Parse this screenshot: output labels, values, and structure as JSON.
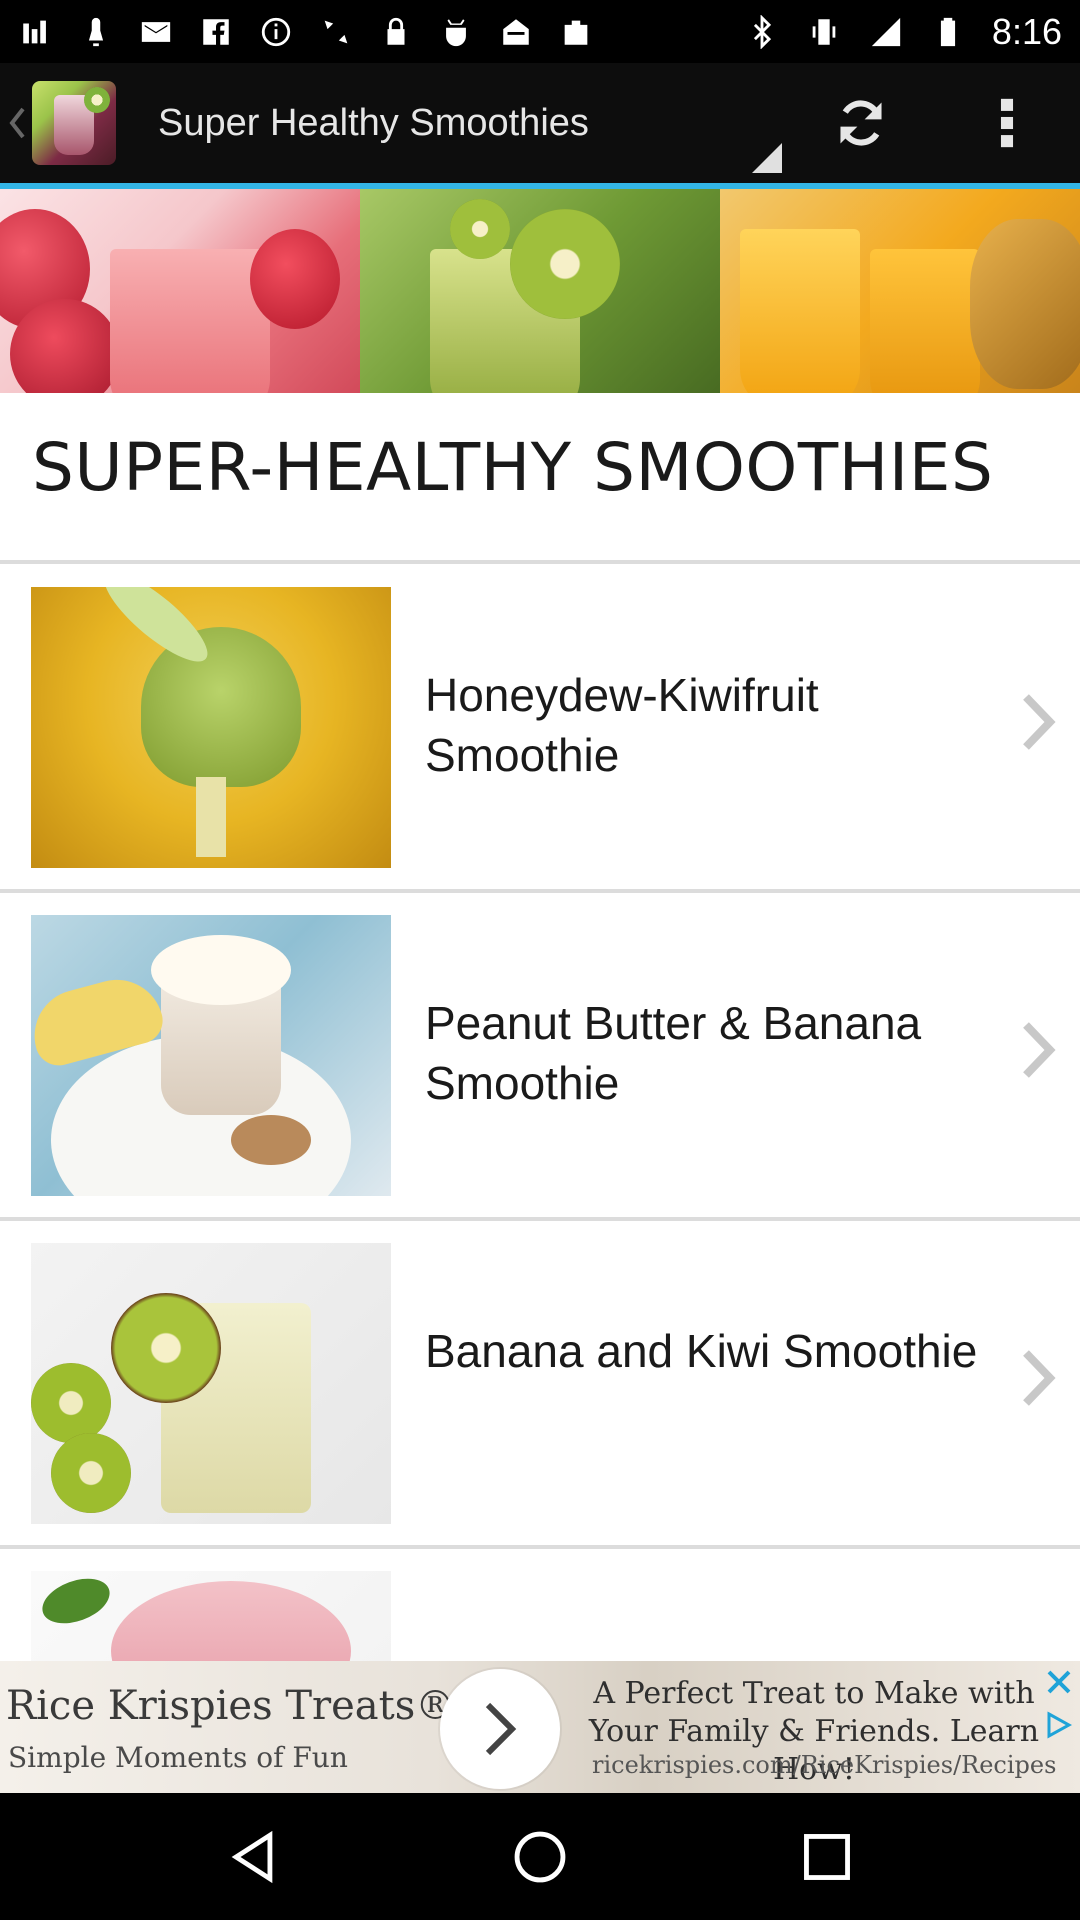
{
  "status_bar": {
    "time": "8:16",
    "left_icons": [
      "wifi-signal-icon",
      "notification-icon",
      "gmail-icon",
      "facebook-icon",
      "info-icon",
      "gps-icon",
      "lock-icon",
      "android-icon",
      "inbox-icon",
      "bag-icon"
    ],
    "right_icons": [
      "bluetooth-icon",
      "vibrate-icon",
      "signal-icon",
      "battery-icon"
    ]
  },
  "action_bar": {
    "title": "Super Healthy Smoothies",
    "refresh_icon": "refresh-icon",
    "overflow_icon": "more-vert-icon"
  },
  "page": {
    "heading": "SUPER-HEALTHY SMOOTHIES"
  },
  "list": {
    "items": [
      {
        "title": "Honeydew-Kiwifruit Smoothie"
      },
      {
        "title": "Peanut Butter & Banana Smoothie"
      },
      {
        "title": "Banana and Kiwi Smoothie"
      }
    ]
  },
  "ad": {
    "title": "Rice Krispies Treats®",
    "subtitle": "Simple Moments of Fun",
    "body": "A Perfect Treat to Make with Your Family & Friends. Learn How!",
    "url": "ricekrispies.com/RiceKrispies/Recipes"
  },
  "colors": {
    "accent": "#33b5e5",
    "action_bar": "#0d0d0d",
    "background": "#ffffff"
  }
}
